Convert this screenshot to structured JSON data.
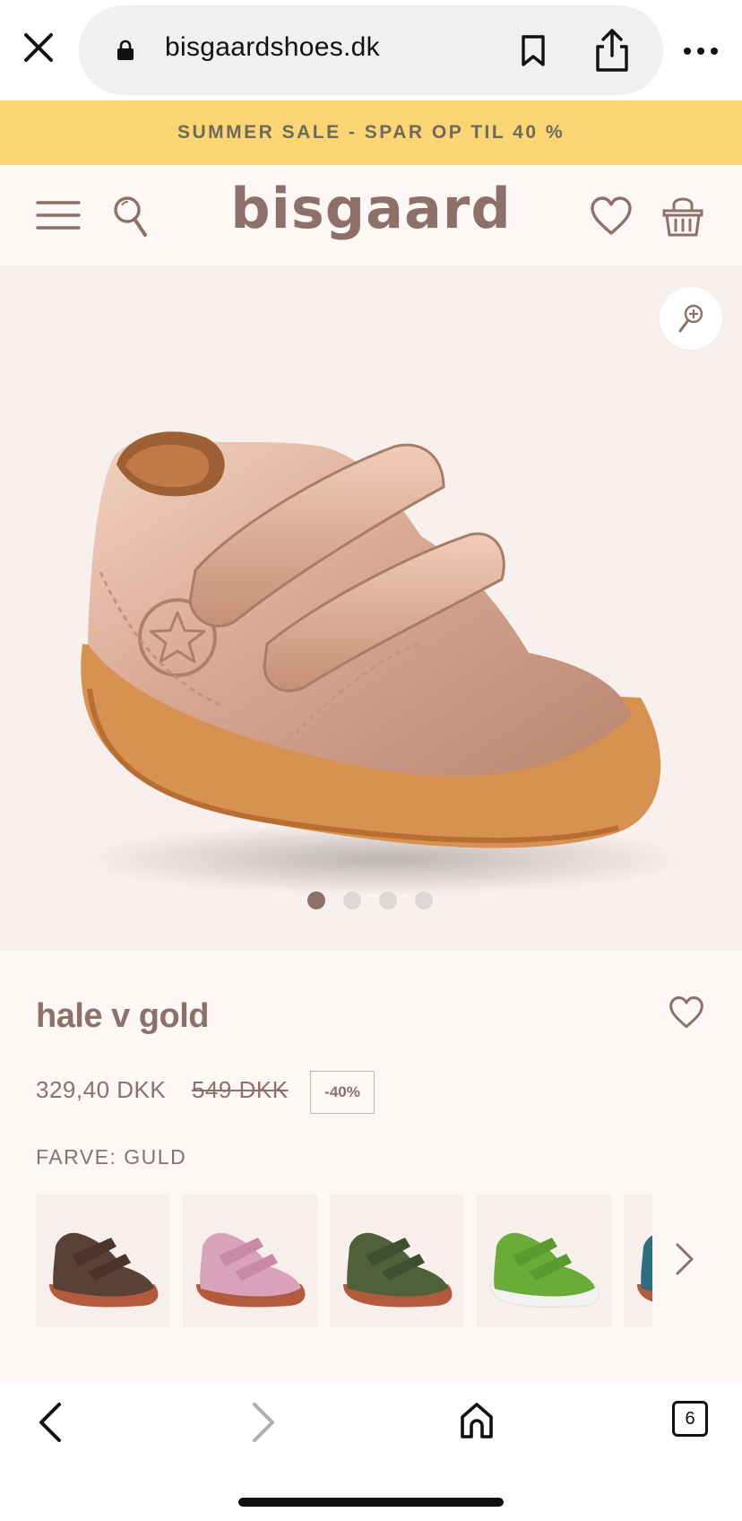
{
  "browser": {
    "url": "bisgaardshoes.dk",
    "tab_count": "6",
    "icons": {
      "close": "close-icon",
      "lock": "lock-icon",
      "bookmark": "bookmark-icon",
      "share": "share-icon",
      "more": "more-icon",
      "back": "chevron-left-icon",
      "forward": "chevron-right-icon",
      "home": "home-icon",
      "tabs": "tabs-icon"
    }
  },
  "banner": {
    "text": "SUMMER SALE - SPAR OP TIL 40 %"
  },
  "header": {
    "logo": "bisgaard",
    "icons": [
      "menu-icon",
      "search-icon",
      "heart-icon",
      "basket-icon"
    ]
  },
  "gallery": {
    "image_count": 4,
    "active_index": 0
  },
  "product": {
    "name": "hale v gold",
    "price": "329,40 DKK",
    "old_price": "549 DKK",
    "discount": "-40%",
    "color_label": "FARVE: GULD"
  },
  "swatches": [
    {
      "color": "#5a4136",
      "sole": "#b35a3d"
    },
    {
      "color": "#d8a3b8",
      "sole": "#b35a3d"
    },
    {
      "color": "#4f6138",
      "sole": "#b35a3d"
    },
    {
      "color": "#6aab3a",
      "sole": "#f2f2f2"
    },
    {
      "color": "#2f6c80",
      "sole": "#b35a3d"
    }
  ],
  "colors": {
    "brand": "#8d7169",
    "banner_bg": "#fcd673",
    "page_bg": "#fdf8f6"
  }
}
